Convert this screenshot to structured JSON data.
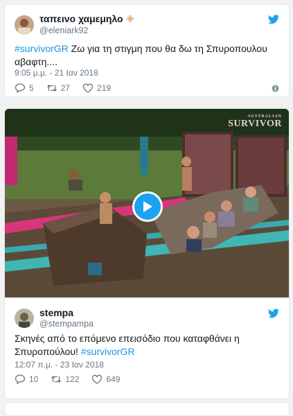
{
  "tweets": [
    {
      "display_name": "ταπεινο χαμεμηλο",
      "handle": "@eleniark92",
      "text_hashtag": "#survivorGR",
      "text_rest": " Ζω για τη στιγμη που θα δω τη Σπυροπουλου αβαφτη....",
      "timestamp": "9:05 μ.μ. - 21 Ιαν 2018",
      "replies": "5",
      "retweets": "27",
      "likes": "219",
      "icons": {
        "reply": "reply-icon",
        "retweet": "retweet-icon",
        "like": "heart-icon",
        "info": "info-icon",
        "brand": "twitter-bird-icon"
      }
    },
    {
      "display_name": "stempa",
      "handle": "@stempampa",
      "text_main": "Σκηνές από το επόμενο επεισόδιο που καταφθάνει η Σπυροπούλου! ",
      "text_hashtag": "#survivorGR",
      "timestamp": "12:07 π.μ. - 23 Ιαν 2018",
      "replies": "10",
      "retweets": "122",
      "likes": "649",
      "media": {
        "watermark": "SURVIVOR",
        "watermark_top": "AUSTRALIAN",
        "play_icon": "play-icon"
      }
    }
  ],
  "colors": {
    "accent": "#1da1f2",
    "hashtag": "#1b95e0",
    "muted": "#657786"
  }
}
